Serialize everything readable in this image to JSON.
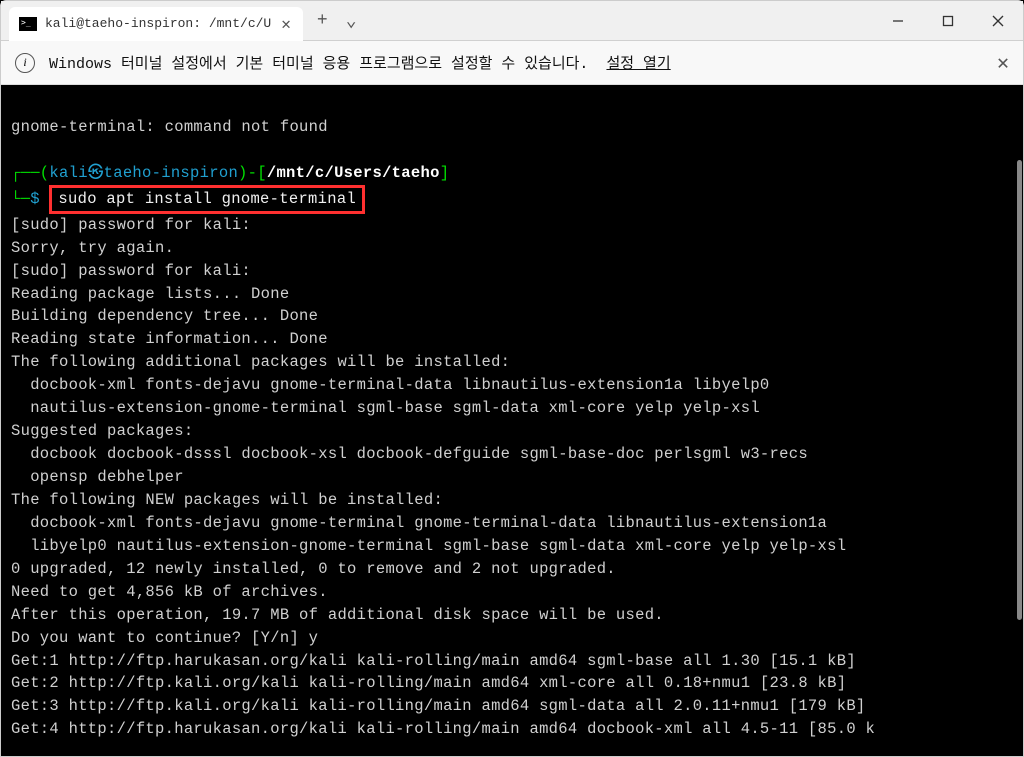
{
  "window": {
    "tab_title": "kali@taeho-inspiron: /mnt/c/U",
    "new_tab": "+",
    "dropdown": "⌄"
  },
  "infobar": {
    "text": "Windows 터미널 설정에서 기본 터미널 응용 프로그램으로 설정할 수 있습니다.",
    "link": "설정 열기"
  },
  "prompt": {
    "user": "kali",
    "host": "taeho-inspiron",
    "path": "/mnt/c/Users/taeho",
    "symbol": "$",
    "command": "sudo apt install gnome-terminal"
  },
  "lines": {
    "l0": "gnome-terminal: command not found",
    "l1": "[sudo] password for kali:",
    "l2": "Sorry, try again.",
    "l3": "[sudo] password for kali:",
    "l4": "Reading package lists... Done",
    "l5": "Building dependency tree... Done",
    "l6": "Reading state information... Done",
    "l7": "The following additional packages will be installed:",
    "l8": "  docbook-xml fonts-dejavu gnome-terminal-data libnautilus-extension1a libyelp0",
    "l9": "  nautilus-extension-gnome-terminal sgml-base sgml-data xml-core yelp yelp-xsl",
    "l10": "Suggested packages:",
    "l11": "  docbook docbook-dsssl docbook-xsl docbook-defguide sgml-base-doc perlsgml w3-recs",
    "l12": "  opensp debhelper",
    "l13": "The following NEW packages will be installed:",
    "l14": "  docbook-xml fonts-dejavu gnome-terminal gnome-terminal-data libnautilus-extension1a",
    "l15": "  libyelp0 nautilus-extension-gnome-terminal sgml-base sgml-data xml-core yelp yelp-xsl",
    "l16": "0 upgraded, 12 newly installed, 0 to remove and 2 not upgraded.",
    "l17": "Need to get 4,856 kB of archives.",
    "l18": "After this operation, 19.7 MB of additional disk space will be used.",
    "l19": "Do you want to continue? [Y/n] y",
    "l20": "Get:1 http://ftp.harukasan.org/kali kali-rolling/main amd64 sgml-base all 1.30 [15.1 kB]",
    "l21": "Get:2 http://ftp.kali.org/kali kali-rolling/main amd64 xml-core all 0.18+nmu1 [23.8 kB]",
    "l22": "Get:3 http://ftp.kali.org/kali kali-rolling/main amd64 sgml-data all 2.0.11+nmu1 [179 kB]",
    "l23": "Get:4 http://ftp.harukasan.org/kali kali-rolling/main amd64 docbook-xml all 4.5-11 [85.0 k"
  }
}
